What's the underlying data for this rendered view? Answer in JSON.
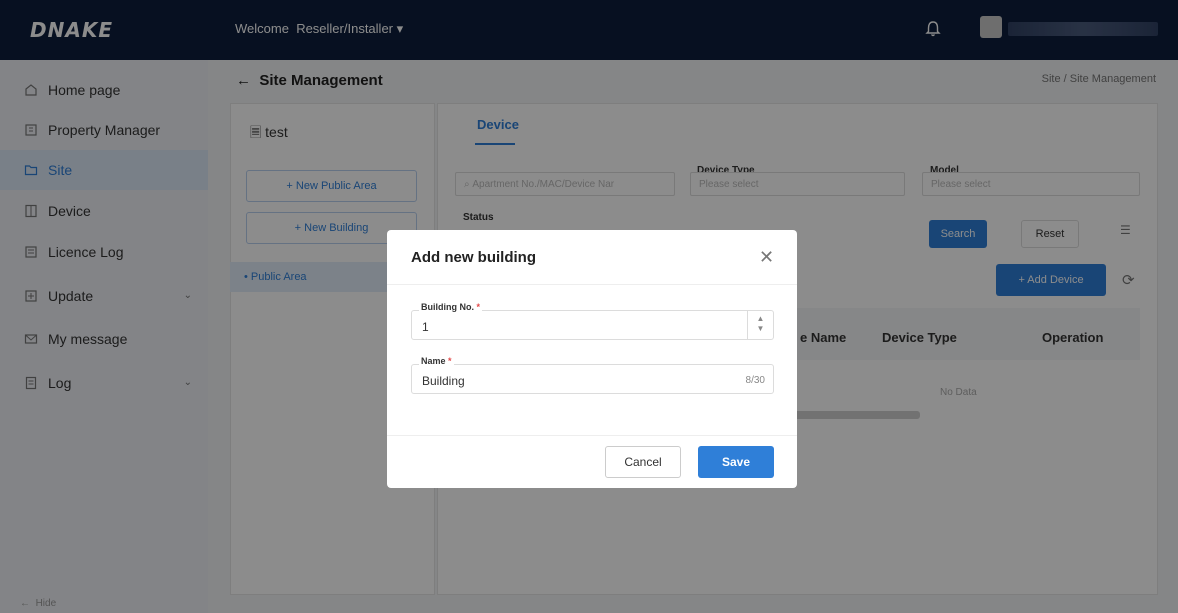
{
  "header": {
    "logo": "DNAKE",
    "welcome_label": "Welcome",
    "role": "Reseller/Installer ▾"
  },
  "sidebar": {
    "items": [
      {
        "label": "Home page",
        "icon": "home-icon"
      },
      {
        "label": "Property Manager",
        "icon": "building-icon"
      },
      {
        "label": "Site",
        "icon": "folder-icon"
      },
      {
        "label": "Device",
        "icon": "device-icon"
      },
      {
        "label": "Licence Log",
        "icon": "licence-icon"
      },
      {
        "label": "Update",
        "icon": "update-icon"
      },
      {
        "label": "My message",
        "icon": "message-icon"
      },
      {
        "label": "Log",
        "icon": "log-icon"
      }
    ],
    "hide_label": "Hide"
  },
  "page": {
    "title": "Site Management",
    "breadcrumb": "Site / Site Management"
  },
  "left_panel": {
    "site_name": "test",
    "new_public_area": "+  New Public Area",
    "new_building": "+  New Building",
    "public_area": "• Public Area"
  },
  "right_panel": {
    "tab": "Device",
    "search_placeholder": "Apartment No./MAC/Device Nar",
    "device_type_label": "Device Type",
    "device_type_placeholder": "Please select",
    "model_label": "Model",
    "model_placeholder": "Please select",
    "status_label": "Status",
    "search_btn": "Search",
    "reset_btn": "Reset",
    "add_device_btn": "+ Add Device",
    "columns": [
      "e Name",
      "Device Type",
      "Operation"
    ],
    "no_data": "No Data"
  },
  "modal": {
    "title": "Add new building",
    "building_no_label": "Building No.",
    "building_no_value": "1",
    "name_label": "Name",
    "name_value": "Building",
    "name_counter": "8/30",
    "cancel": "Cancel",
    "save": "Save"
  },
  "colors": {
    "primary": "#2f7fd8",
    "topbar": "#0d1e3c",
    "required": "#e34a4a"
  }
}
